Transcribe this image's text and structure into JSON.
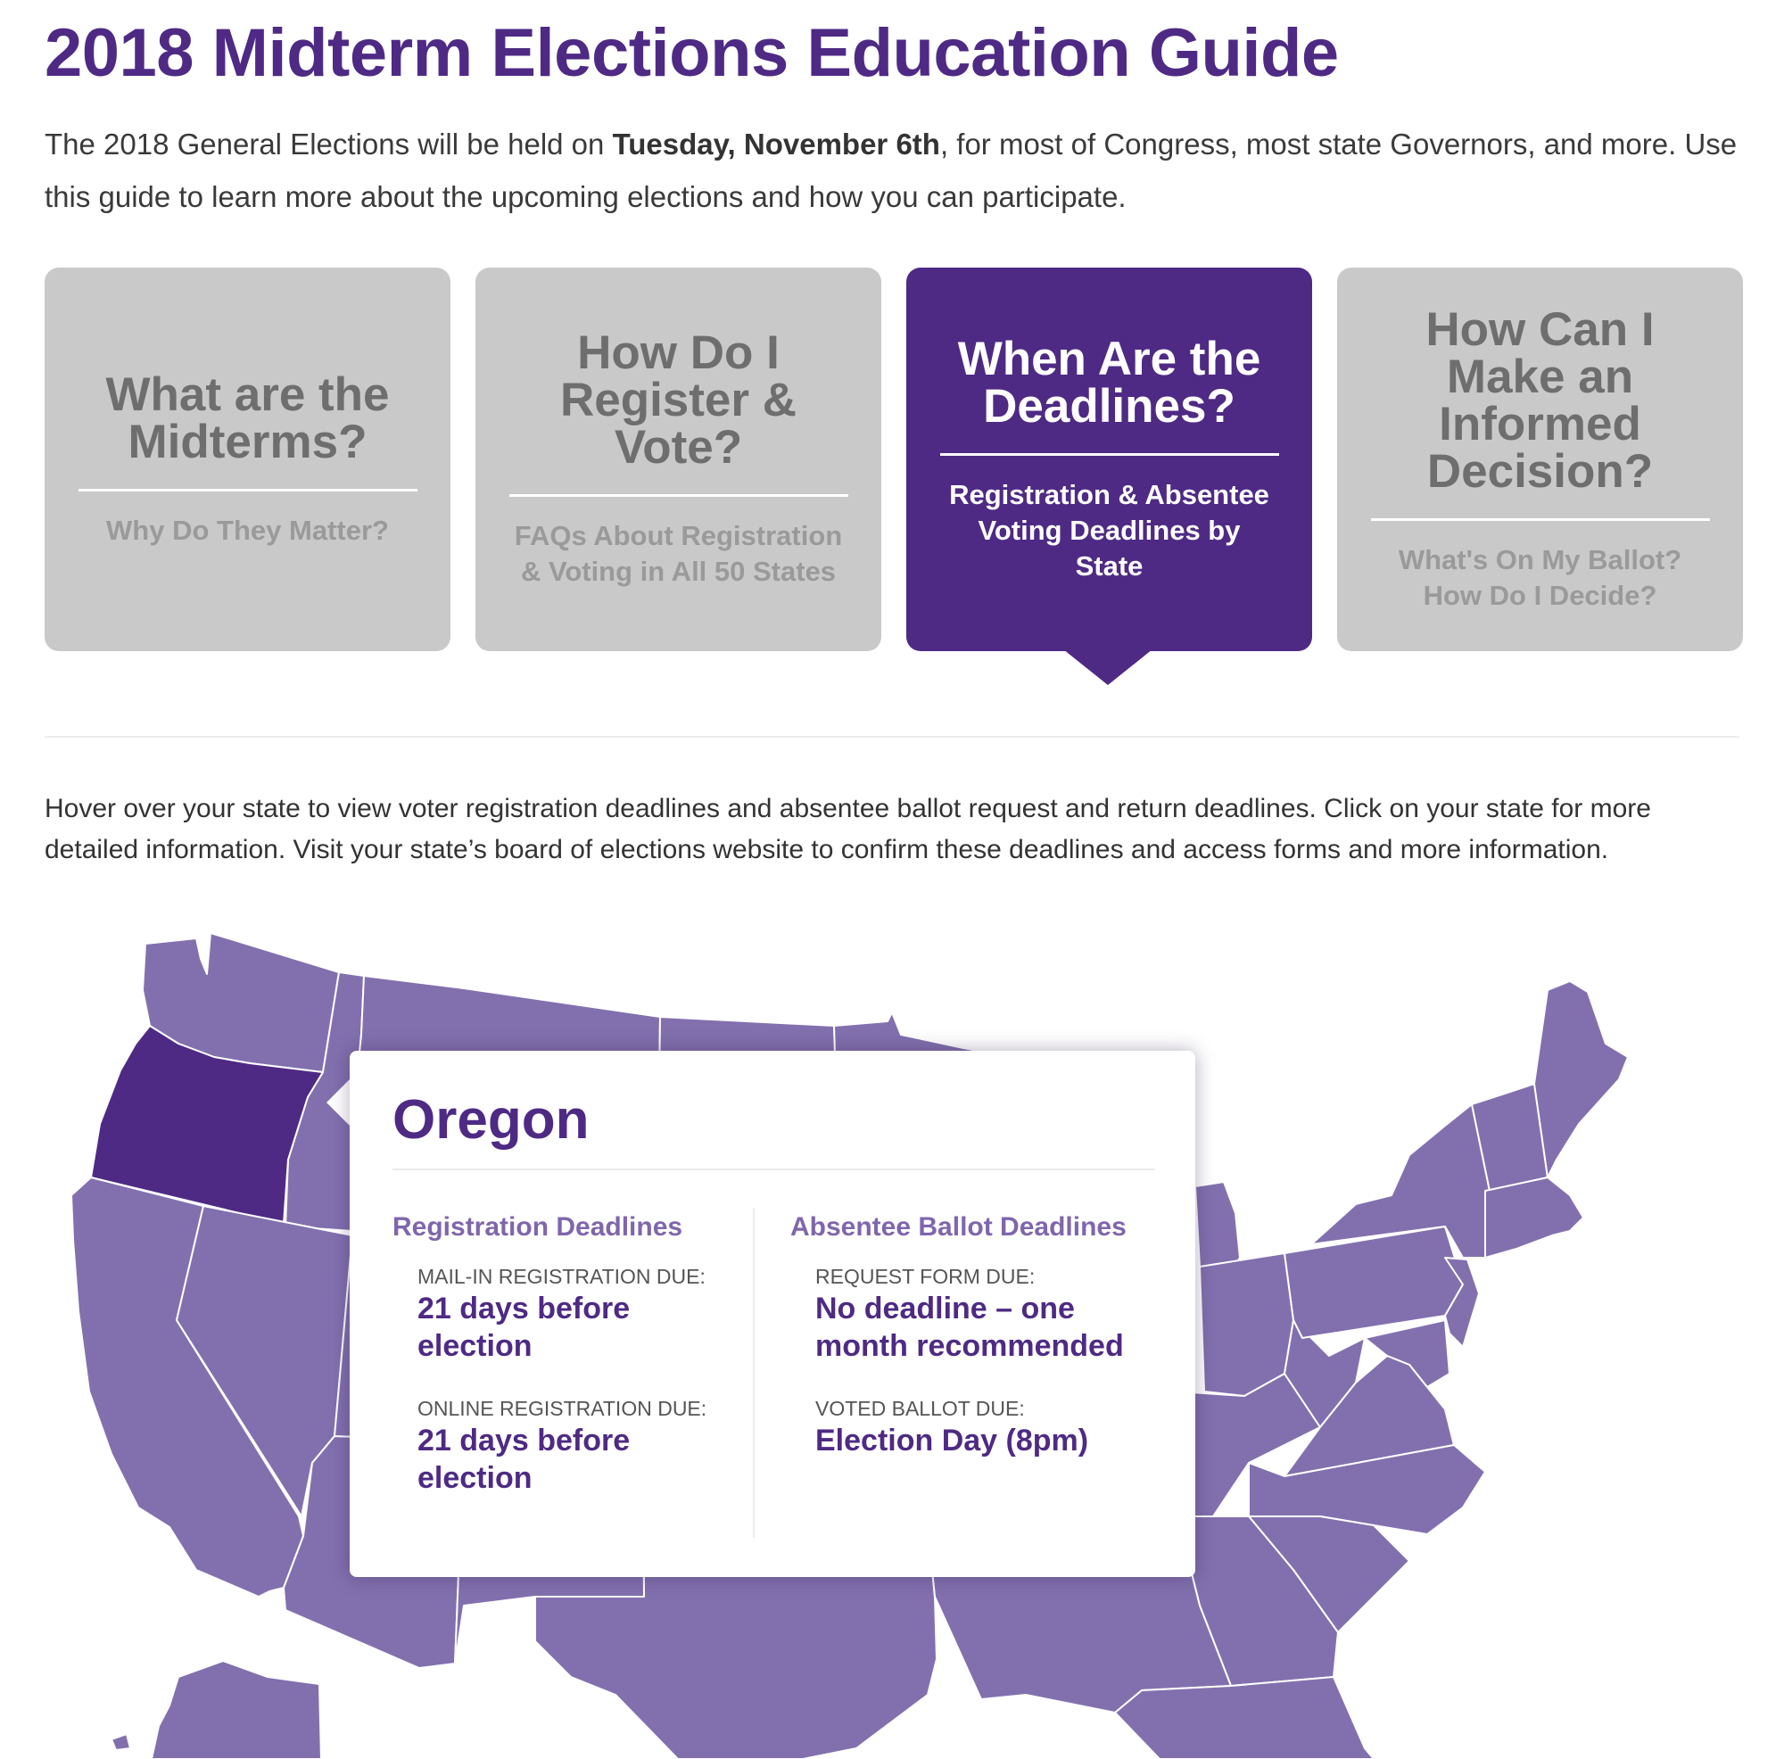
{
  "page": {
    "title": "2018 Midterm Elections Education Guide",
    "intro_before": "The 2018 General Elections will be held on ",
    "intro_bold": "Tuesday, November 6th",
    "intro_after": ", for most of Congress, most state Governors, and more. Use this guide to learn more about the upcoming elections and how you can participate."
  },
  "cards": [
    {
      "title": "What are the\nMidterms?",
      "subtitle": "Why Do They Matter?",
      "active": false
    },
    {
      "title": "How Do I\nRegister &\nVote?",
      "subtitle": "FAQs About Registration\n& Voting in All 50 States",
      "active": false
    },
    {
      "title": "When Are the\nDeadlines?",
      "subtitle": "Registration & Absentee\nVoting Deadlines by\nState",
      "active": true
    },
    {
      "title": "How Can I\nMake an\nInformed\nDecision?",
      "subtitle": "What's On My Ballot?\nHow Do I Decide?",
      "active": false
    }
  ],
  "instructions": "Hover over your state to view voter registration deadlines and absentee ballot request and return deadlines. Click on your state for more detailed information. Visit your state’s board of elections website to confirm these deadlines and access forms and more information.",
  "map": {
    "colors": {
      "state_fill": "#8270ae",
      "selected_fill": "#4e2a84",
      "border": "#ffffff"
    },
    "selected_state": "Oregon"
  },
  "tooltip": {
    "state": "Oregon",
    "registration": {
      "heading": "Registration Deadlines",
      "items": [
        {
          "label": "MAIL-IN REGISTRATION DUE:",
          "value": "21 days before election"
        },
        {
          "label": "ONLINE REGISTRATION DUE:",
          "value": "21 days before election"
        }
      ]
    },
    "absentee": {
      "heading": "Absentee Ballot Deadlines",
      "items": [
        {
          "label": "REQUEST FORM DUE:",
          "value": "No deadline – one month recommended"
        },
        {
          "label": "VOTED BALLOT DUE:",
          "value": "Election Day (8pm)"
        }
      ]
    }
  },
  "theme": {
    "accent": "#4e2a84",
    "card_inactive": "#c9c9c9",
    "heading_light": "#7f66ac"
  }
}
